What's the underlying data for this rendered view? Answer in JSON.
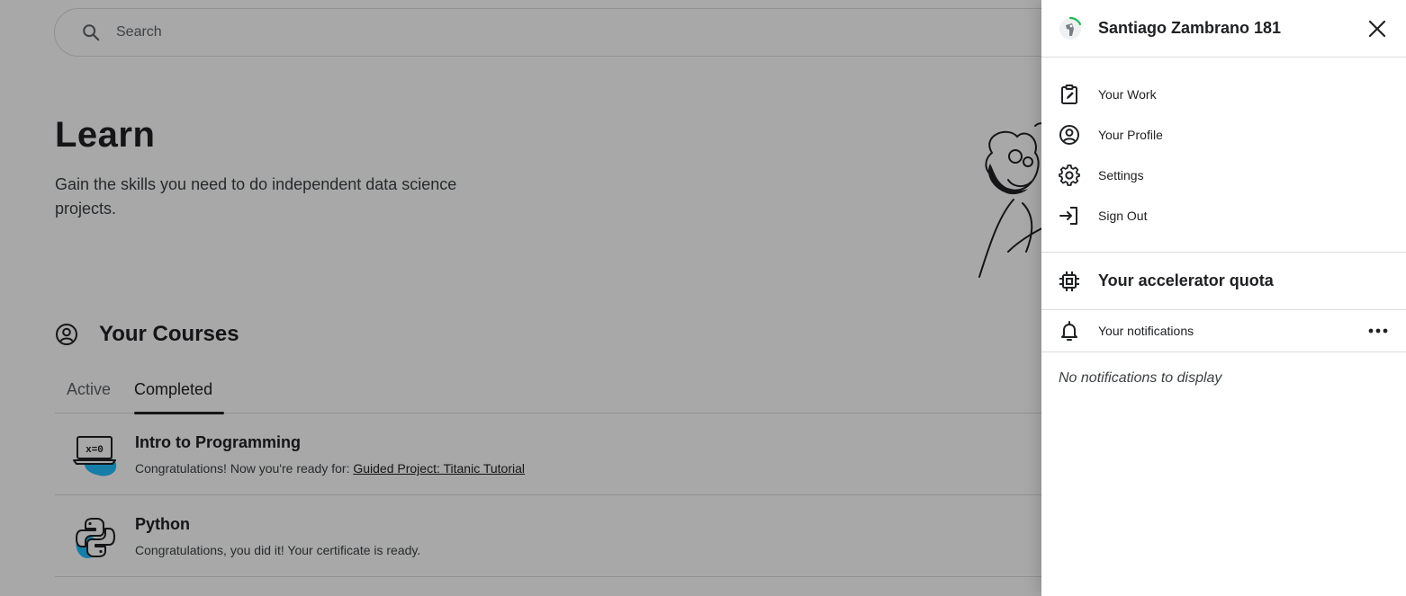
{
  "search": {
    "placeholder": "Search"
  },
  "hero": {
    "title": "Learn",
    "subtitle": "Gain the skills you need to do independent data science projects."
  },
  "courses": {
    "heading": "Your Courses",
    "tabs": [
      {
        "label": "Active",
        "selected": false
      },
      {
        "label": "Completed",
        "selected": true
      }
    ],
    "items": [
      {
        "title": "Intro to Programming",
        "desc_prefix": "Congratulations! Now you're ready for: ",
        "desc_link": "Guided Project: Titanic Tutorial",
        "icon": "laptop-icon"
      },
      {
        "title": "Python",
        "desc_prefix": "Congratulations, you did it! Your certificate is ready.",
        "desc_link": "",
        "icon": "python-icon"
      }
    ]
  },
  "drawer": {
    "user_name": "Santiago Zambrano 181",
    "menu": [
      {
        "label": "Your Work",
        "icon": "clipboard-edit-icon"
      },
      {
        "label": "Your Profile",
        "icon": "profile-icon"
      },
      {
        "label": "Settings",
        "icon": "gear-icon"
      },
      {
        "label": "Sign Out",
        "icon": "sign-out-icon"
      }
    ],
    "quota_label": "Your accelerator quota",
    "notifications_label": "Your notifications",
    "empty_notifications": "No notifications to display"
  },
  "colors": {
    "accent_blue": "#20BEFF",
    "progress_green": "#1DB954",
    "overlay": "rgba(0,0,0,0.34)"
  }
}
